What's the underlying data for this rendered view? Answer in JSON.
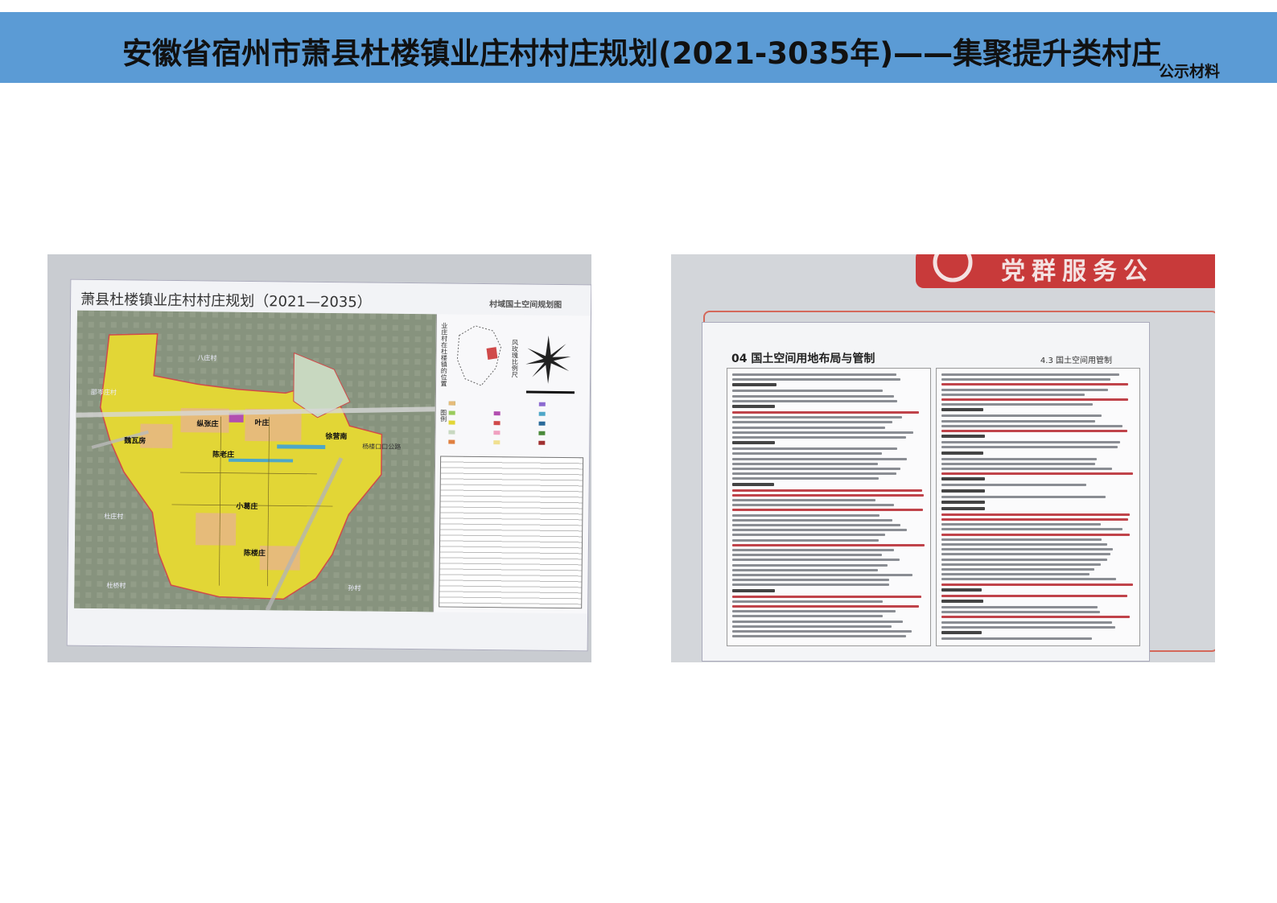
{
  "header": {
    "title": "安徽省宿州市萧县杜楼镇业庄村村庄规划(2021-3035年)——集聚提升类村庄",
    "subtitle": "公示材料",
    "background_color": "#5b9bd5"
  },
  "left_photo": {
    "poster_title": "萧县杜楼镇业庄村村庄规划（2021—2035）",
    "poster_subtitle": "村域国土空间规划图",
    "side_label_location": "业庄村在杜楼镇的位置",
    "side_label_compass": "风玫瑰比例尺",
    "side_label_legend": "图例",
    "villages": [
      "纵张庄",
      "叶庄",
      "魏瓦房",
      "陈老庄",
      "徐营南",
      "小葛庄",
      "陈楼庄"
    ],
    "neighbors": [
      "八庄村",
      "杜庄村",
      "杜桥村",
      "孙村",
      "邵岑庄村"
    ],
    "road_label": "杨楼口口公路",
    "colors": {
      "farmland": "#e5d93a",
      "settlement": "#e8c48f",
      "industry": "#b24fb0",
      "water": "#4ea7c8"
    }
  },
  "right_photo": {
    "sign_text": "党群服务公",
    "section_title": "04 国土空间用地布局与管制",
    "section_subtitle": "4.3 国土空间用管制"
  }
}
